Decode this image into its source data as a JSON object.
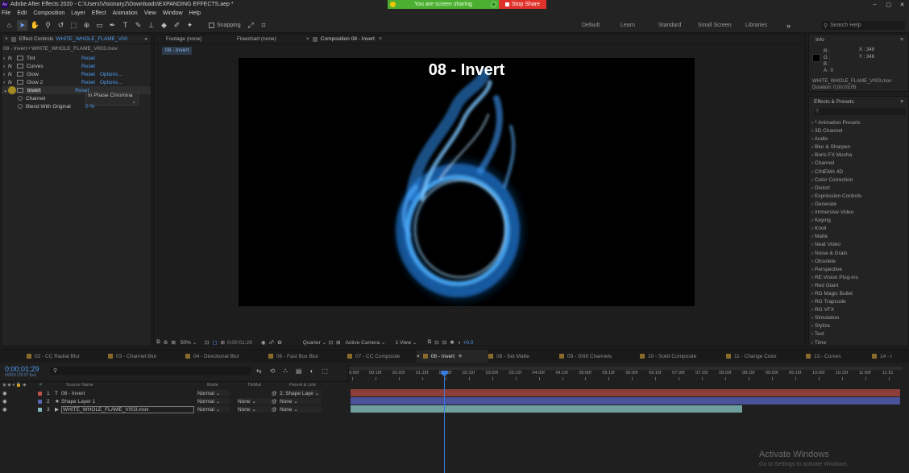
{
  "app": {
    "title": "Adobe After Effects 2020 - C:\\Users\\Visionary2\\Downloads\\EXPANDING EFFECTS.aep *",
    "logo": "Ae",
    "share_status": "You are screen sharing",
    "stop_share": "Stop Share",
    "win_controls": [
      "–",
      "▢",
      "✕"
    ]
  },
  "menu": [
    "File",
    "Edit",
    "Composition",
    "Layer",
    "Effect",
    "Animation",
    "View",
    "Window",
    "Help"
  ],
  "toolbar": {
    "snapping": "Snapping",
    "workspaces": [
      "Default",
      "Learn",
      "Standard",
      "Small Screen",
      "Libraries"
    ],
    "more": "»",
    "search_placeholder": "Search Help"
  },
  "effect_controls": {
    "tab": "Effect Controls",
    "tab_layer": "WHITE_WHOLE_FLAME_V00",
    "subtitle": "08 - Invert • WHITE_WHOLE_FLAME_V003.mov",
    "effects": [
      {
        "name": "Tint",
        "reset": "Reset",
        "options": ""
      },
      {
        "name": "Curves",
        "reset": "Reset",
        "options": ""
      },
      {
        "name": "Glow",
        "reset": "Reset",
        "options": "Options..."
      },
      {
        "name": "Glow 2",
        "reset": "Reset",
        "options": "Options..."
      },
      {
        "name": "Invert",
        "reset": "Reset",
        "options": ""
      }
    ],
    "channel_label": "Channel",
    "channel_value": "In Phase Chromina",
    "blend_label": "Blend With Original",
    "blend_value": "0 %"
  },
  "composition": {
    "tabs": [
      "Footage (none)",
      "Flowchart (none)",
      "Composition 08 - Invert"
    ],
    "breadcrumb": "08 - Invert",
    "title": "08 - Invert",
    "zoom": "50%",
    "timecode": "0;00;01;29",
    "resolution": "Quarter",
    "camera": "Active Camera",
    "views": "1 View",
    "exposure": "+0.0"
  },
  "info": {
    "title": "Info",
    "r": "R :",
    "g": "G :",
    "b": "B :",
    "a": "A : 0",
    "x": "X : 348",
    "y": "Y : 346",
    "file": "WHITE_WHOLE_FLAME_V003.mov",
    "duration": "Duration: 0;00;03;05"
  },
  "presets": {
    "title": "Effects & Presets",
    "items": [
      "* Animation Presets",
      "3D Channel",
      "Audio",
      "Blur & Sharpen",
      "Boris FX Mocha",
      "Channel",
      "CINEMA 4D",
      "Color Correction",
      "Distort",
      "Expression Controls",
      "Generate",
      "Immersive Video",
      "Keying",
      "Knoll",
      "Matte",
      "Neat Video",
      "Noise & Grain",
      "Obsolete",
      "Perspective",
      "RE:Vision Plug-ins",
      "Red Giant",
      "RG Magic Bullet",
      "RG Trapcode",
      "RG VFX",
      "Simulation",
      "Stylize",
      "Text",
      "Time"
    ]
  },
  "timeline": {
    "tabs": [
      "02 - CC Radial Blur",
      "03 - Channel Blur",
      "04 - Directional Blur",
      "06 - Fast Box Blur",
      "07 - CC Composite",
      "08 - Invert",
      "08 - Set Matte",
      "09 - Shift Channels",
      "10 - Solid Composite",
      "11 - Change Color",
      "13 - Curves",
      "14 - I"
    ],
    "timecode": "0;00;01;29",
    "fps": "00059 (29.97 fps)",
    "columns": {
      "source": "Source Name",
      "mode": "Mode",
      "trkmat": "TrkMat",
      "parent": "Parent & Link"
    },
    "layers": [
      {
        "num": "1",
        "name": "08 - Invert",
        "mode": "Normal",
        "trkmat": "",
        "parent": "2. Shape Laye",
        "color": "#c0504a"
      },
      {
        "num": "2",
        "name": "Shape Layer 1",
        "mode": "Normal",
        "trkmat": "None",
        "parent": "None",
        "color": "#5a64b6"
      },
      {
        "num": "3",
        "name": "WHITE_WHOLE_FLAME_V003.mov",
        "mode": "Normal",
        "trkmat": "None",
        "parent": "None",
        "color": "#7fb6b6"
      }
    ],
    "ruler": [
      "0:00f",
      "00:15f",
      "01:00f",
      "01:15f",
      "02:00f",
      "02:15f",
      "03:00f",
      "03:15f",
      "04:00f",
      "04:15f",
      "05:00f",
      "05:15f",
      "06:00f",
      "06:15f",
      "07:00f",
      "07:15f",
      "08:00f",
      "08:15f",
      "09:00f",
      "09:15f",
      "10:00f",
      "10:15f",
      "11:00f",
      "11:15"
    ],
    "activate": "Activate Windows",
    "activate_sub": "Go to Settings to activate Windows."
  },
  "colors": {
    "accent": "#4e9cf0",
    "playhead": "#3a7be0",
    "flame": "#3aa0ff"
  }
}
